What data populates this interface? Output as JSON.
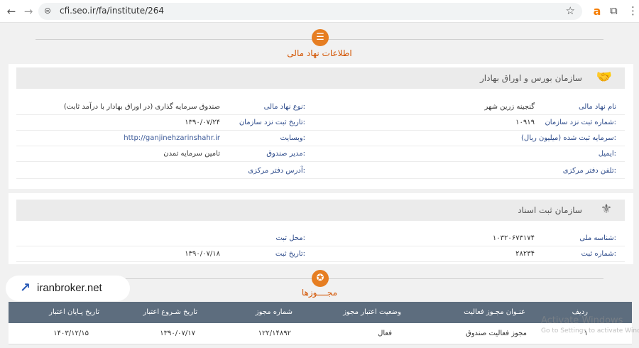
{
  "browser": {
    "url": "cfi.seo.ir/fa/institute/264",
    "back_icon": "←",
    "forward_icon": "→",
    "reload_icon": "↻",
    "site_icon": "⊜",
    "star_icon": "☆",
    "ext_icon": "a",
    "puzzle_icon": "⧉",
    "menu_icon": "⋮"
  },
  "institute": {
    "section_title": "اطلاعات نهاد مالی",
    "icon": "☰"
  },
  "org1": {
    "name": "سازمان بورس و اوراق بهادار",
    "fields": {
      "institute_name_label": "نام نهاد مالی",
      "institute_name_value": "گنجینه زرین شهر",
      "type_label": "نوع نهاد مالی:",
      "type_value": "صندوق سرمایه گذاری (در اوراق بهادار با درآمد ثابت)",
      "reg_no_label": "شماره ثبت نزد سازمان:",
      "reg_no_value": "۱۰۹۱۹",
      "reg_date_label": "تاریخ ثبت نزد سازمان:",
      "reg_date_value": "۱۳۹۰/۰۷/۲۴",
      "capital_label": "سرمایه ثبت شده (میلیون ریال):",
      "website_label": "وبسایت:",
      "website_value": "http://ganjinehzarinshahr.ir",
      "email_label": "ایمیل:",
      "manager_label": "مدیر صندوق:",
      "manager_value": "تامین سرمایه تمدن",
      "phone_label": "تلفن دفتر مرکزی:",
      "address_label": "آدرس دفتر مرکزی:"
    }
  },
  "org2": {
    "name": "سازمان ثبت اسناد",
    "fields": {
      "national_id_label": "شناسه ملی:",
      "national_id_value": "۱۰۳۲۰۶۷۳۱۷۴",
      "reg_place_label": "محل ثبت:",
      "reg_no_label": "شماره ثبت:",
      "reg_no_value": "۲۸۲۳۴",
      "reg_date_label": "تاریخ ثبت:",
      "reg_date_value": "۱۳۹۰/۰۷/۱۸"
    }
  },
  "licenses": {
    "section_title": "مجــــوزها",
    "icon": "✪",
    "columns": [
      "ردیف",
      "عنـوان مجـوز فعالیت",
      "وضعیت اعتبار مجوز",
      "شماره مجوز",
      "تاریخ شـروع اعتبار",
      "تاریخ پـایان اعتبار"
    ],
    "rows": [
      [
        "١",
        "مجوز فعالیت صندوق",
        "فعال",
        "۱۲۲/۱۴۸۹۲",
        "۱۳۹۰/۰۷/۱۷",
        "۱۴۰۳/۱۲/۱۵"
      ]
    ]
  },
  "watermark_badge": {
    "text": "iranbroker.net"
  },
  "windows_watermark": {
    "line1": "Activate Windows",
    "line2": "Go to Settings to activate Windows."
  }
}
